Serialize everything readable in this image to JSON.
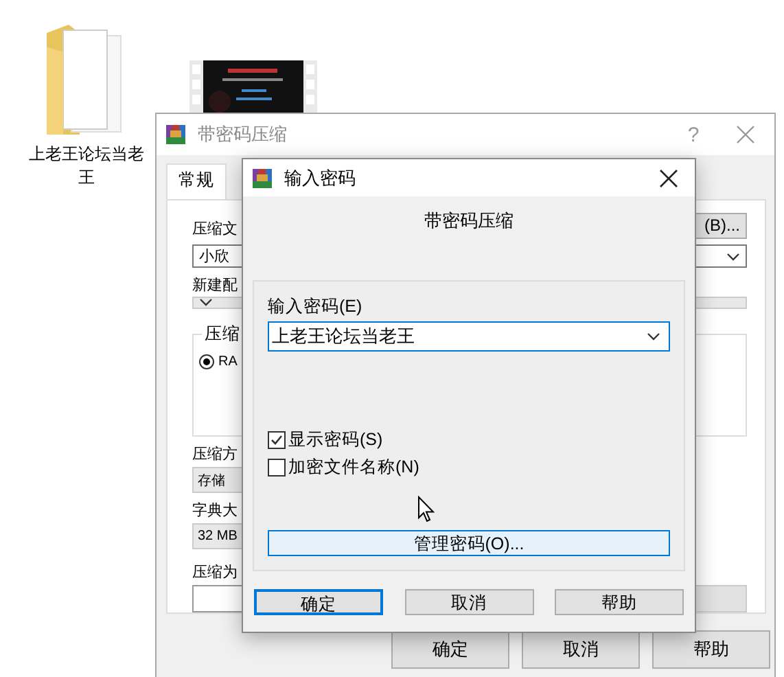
{
  "desktop": {
    "folder": {
      "label": "上老王论坛当老王"
    }
  },
  "back_window": {
    "title": "带密码压缩",
    "help_button": "?",
    "tabs": [
      {
        "label": "常规",
        "selected": true
      }
    ],
    "archive_name_label": "压缩文",
    "browse_button": "(B)...",
    "archive_name_value": "小欣",
    "profile_label": "新建配",
    "format_group_label": "压缩",
    "format_options": [
      {
        "label": "RA",
        "selected": true
      }
    ],
    "method_label": "压缩方",
    "method_value": "存储",
    "dictionary_label": "字典大",
    "dictionary_value": "32 MB",
    "split_label": "压缩为",
    "buttons": [
      "确定",
      "取消",
      "帮助"
    ]
  },
  "dialog": {
    "title": "输入密码",
    "heading": "带密码压缩",
    "password_label": "输入密码(E)",
    "password_value": "上老王论坛当老王",
    "options": [
      {
        "label": "显示密码(S)",
        "checked": true
      },
      {
        "label": "加密文件名称(N)",
        "checked": false
      }
    ],
    "manage_button": "管理密码(O)...",
    "buttons": [
      {
        "label": "确定",
        "default": true
      },
      {
        "label": "取消",
        "default": false
      },
      {
        "label": "帮助",
        "default": false
      }
    ]
  }
}
